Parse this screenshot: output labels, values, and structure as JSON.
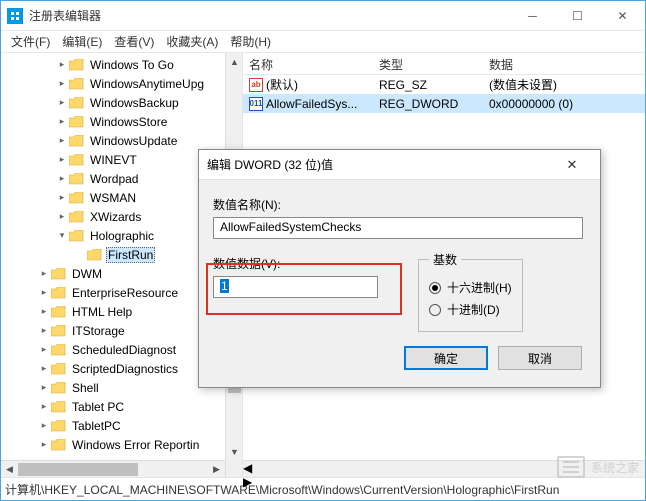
{
  "window": {
    "title": "注册表编辑器"
  },
  "menu": {
    "file": "文件(F)",
    "edit": "编辑(E)",
    "view": "查看(V)",
    "fav": "收藏夹(A)",
    "help": "帮助(H)"
  },
  "tree": {
    "items": [
      {
        "indent": 3,
        "exp": ">",
        "label": "Windows To Go"
      },
      {
        "indent": 3,
        "exp": ">",
        "label": "WindowsAnytimeUpg"
      },
      {
        "indent": 3,
        "exp": ">",
        "label": "WindowsBackup"
      },
      {
        "indent": 3,
        "exp": ">",
        "label": "WindowsStore"
      },
      {
        "indent": 3,
        "exp": ">",
        "label": "WindowsUpdate"
      },
      {
        "indent": 3,
        "exp": ">",
        "label": "WINEVT"
      },
      {
        "indent": 3,
        "exp": ">",
        "label": "Wordpad"
      },
      {
        "indent": 3,
        "exp": ">",
        "label": "WSMAN"
      },
      {
        "indent": 3,
        "exp": ">",
        "label": "XWizards"
      },
      {
        "indent": 3,
        "exp": "v",
        "label": "Holographic"
      },
      {
        "indent": 4,
        "exp": "",
        "label": "FirstRun",
        "selected": true
      },
      {
        "indent": 2,
        "exp": ">",
        "label": "DWM"
      },
      {
        "indent": 2,
        "exp": ">",
        "label": "EnterpriseResource"
      },
      {
        "indent": 2,
        "exp": ">",
        "label": "HTML Help"
      },
      {
        "indent": 2,
        "exp": ">",
        "label": "ITStorage"
      },
      {
        "indent": 2,
        "exp": ">",
        "label": "ScheduledDiagnost"
      },
      {
        "indent": 2,
        "exp": ">",
        "label": "ScriptedDiagnostics"
      },
      {
        "indent": 2,
        "exp": ">",
        "label": "Shell"
      },
      {
        "indent": 2,
        "exp": ">",
        "label": "Tablet PC"
      },
      {
        "indent": 2,
        "exp": ">",
        "label": "TabletPC"
      },
      {
        "indent": 2,
        "exp": ">",
        "label": "Windows Error Reportin"
      }
    ]
  },
  "columns": {
    "name": "名称",
    "type": "类型",
    "data": "数据"
  },
  "values": [
    {
      "icon": "sz",
      "name": "(默认)",
      "type": "REG_SZ",
      "data": "(数值未设置)"
    },
    {
      "icon": "dw",
      "name": "AllowFailedSys...",
      "type": "REG_DWORD",
      "data": "0x00000000 (0)",
      "selected": true
    }
  ],
  "status": {
    "path": "计算机\\HKEY_LOCAL_MACHINE\\SOFTWARE\\Microsoft\\Windows\\CurrentVersion\\Holographic\\FirstRun"
  },
  "dialog": {
    "title": "编辑 DWORD (32 位)值",
    "name_label": "数值名称(N):",
    "name_value": "AllowFailedSystemChecks",
    "data_label": "数值数据(V):",
    "data_value": "1",
    "base_label": "基数",
    "radio_hex": "十六进制(H)",
    "radio_dec": "十进制(D)",
    "ok": "确定",
    "cancel": "取消"
  },
  "watermark": {
    "text": "系统之家"
  }
}
